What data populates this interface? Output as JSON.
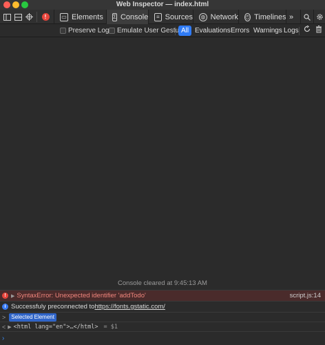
{
  "window": {
    "title": "Web Inspector — index.html"
  },
  "toolbar": {
    "error_count": "!",
    "tabs": [
      {
        "label": "Elements",
        "icon": "elements-icon"
      },
      {
        "label": "Console",
        "icon": "console-icon",
        "active": true
      },
      {
        "label": "Sources",
        "icon": "sources-icon"
      },
      {
        "label": "Network",
        "icon": "network-icon"
      },
      {
        "label": "Timelines",
        "icon": "timelines-icon"
      }
    ],
    "overflow": "»"
  },
  "filter": {
    "preserve_log": "Preserve Log",
    "emulate_user_gesture": "Emulate User Gesture",
    "levels": [
      "All",
      "Evaluations",
      "Errors",
      "Warnings",
      "Logs"
    ],
    "active_level": "All"
  },
  "console": {
    "cleared_message": "Console cleared at 9:45:13 AM",
    "error": {
      "text": "SyntaxError: Unexpected identifier 'addTodo'",
      "source": "script.js:14"
    },
    "info": {
      "prefix": "Successfuly preconnected to ",
      "link": "https://fonts.gstatic.com/"
    },
    "selected_label": "Selected Element",
    "element_output": "<html lang=\"en\">…</html>",
    "element_var": "= $1"
  },
  "colors": {
    "accent": "#2f7bf5",
    "error": "#e8453c",
    "error_row": "#4a2b2b"
  }
}
